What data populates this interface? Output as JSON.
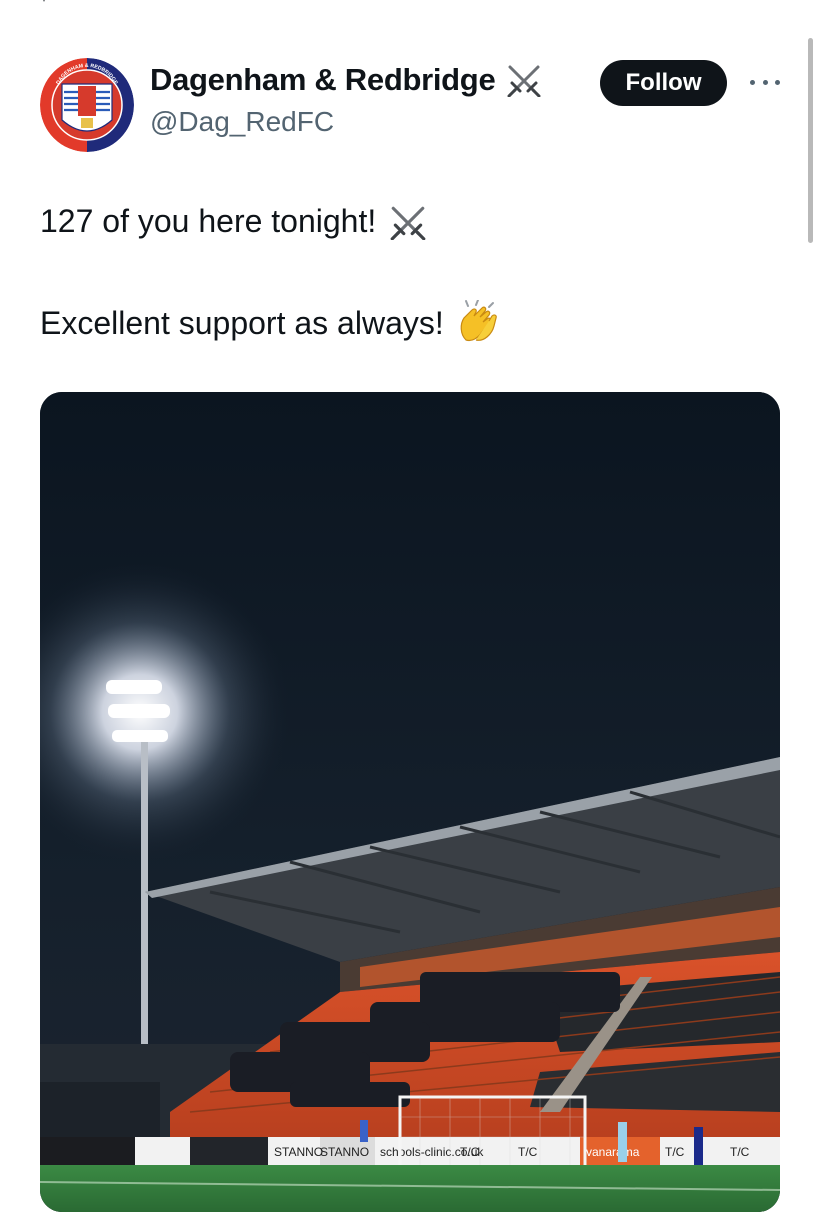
{
  "tweet": {
    "display_name": "Dagenham & Redbridge",
    "handle": "@Dag_RedFC",
    "follow_label": "Follow",
    "text_line1": "127 of you here tonight!",
    "text_line2": "Excellent support as always!",
    "avatar_text": "DAGENHAM & REDBRIDGE"
  },
  "photo": {
    "ad_boards": [
      "STANNO",
      "STANNO",
      "schools-clinic.co.uk",
      "T/C",
      "T/C",
      "vanarama",
      "T/C",
      "T/C"
    ]
  },
  "colors": {
    "text": "#0f1419",
    "secondary": "#536471",
    "follow_bg": "#0f1419",
    "club_red": "#e23a2a",
    "club_blue": "#1f2a7a",
    "seat_orange": "#e8572a",
    "pitch_green": "#2f7a3a"
  },
  "icons": [
    "crossed-swords-icon",
    "clapping-hands-icon",
    "more-options-icon"
  ]
}
